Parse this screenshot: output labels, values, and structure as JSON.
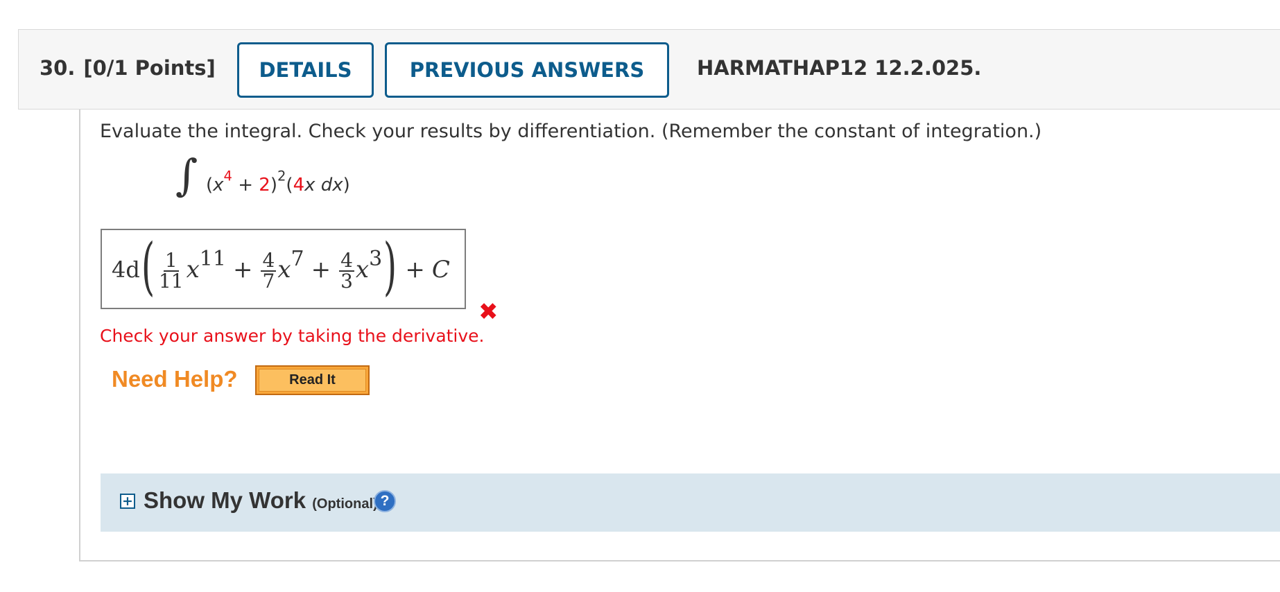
{
  "question": {
    "number": "30.",
    "points": "[0/1 Points]",
    "details_label": "DETAILS",
    "previous_answers_label": "PREVIOUS ANSWERS",
    "code": "HARMATHAP12 12.2.025."
  },
  "prompt": "Evaluate the integral. Check your results by differentiation. (Remember the constant of integration.)",
  "integral": {
    "sign": "∫",
    "open": "(",
    "x": "x",
    "exp4": "4",
    "plus": " + ",
    "two": "2",
    "close_sq": ")",
    "exp2": "2",
    "open2": "(",
    "four": "4",
    "rest": "x dx",
    "close2": ")"
  },
  "answer": {
    "coef": "4d",
    "frac1_num": "1",
    "frac1_den": "11",
    "exp1": "11",
    "frac2_num": "4",
    "frac2_den": "7",
    "exp2": "7",
    "frac3_num": "4",
    "frac3_den": "3",
    "exp3": "3",
    "var": "x",
    "plus": "+",
    "constant": "C",
    "status_icon": "cross-icon"
  },
  "feedback": "Check your answer by taking the derivative.",
  "help": {
    "need_help": "Need Help?",
    "read_it": "Read It"
  },
  "show_my_work": {
    "label": "Show My Work",
    "optional": "(Optional)",
    "toggle": "+",
    "help_icon": "?"
  },
  "colors": {
    "accent_blue": "#0d5c8c",
    "error_red": "#e8101a",
    "help_orange": "#f08a24",
    "work_panel": "#d9e6ee"
  }
}
